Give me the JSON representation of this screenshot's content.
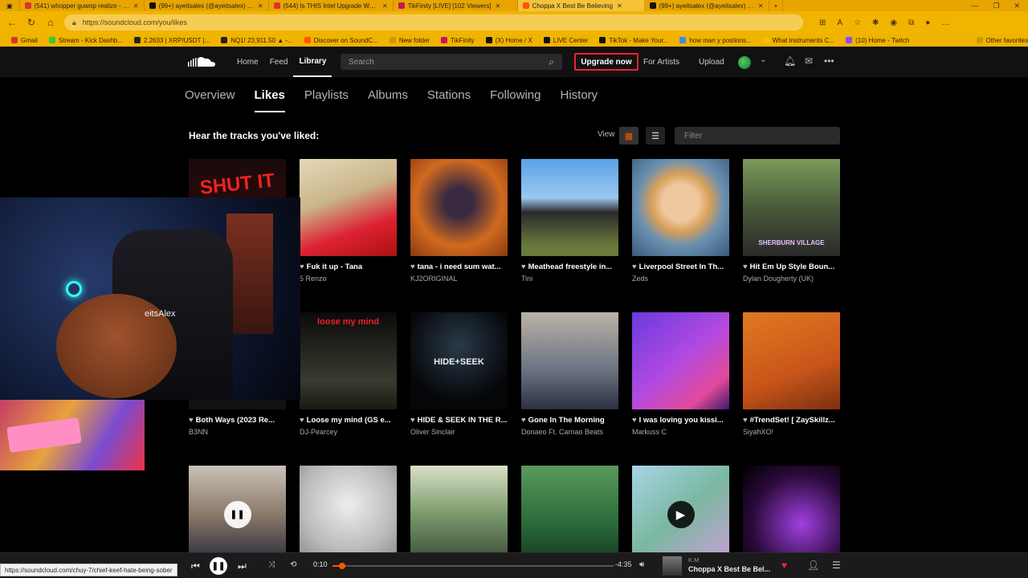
{
  "browser": {
    "tabs": [
      {
        "label": "(541) whopper guwop realize - Yo",
        "color": "#d33"
      },
      {
        "label": "(99+) ayeitsalex (@ayeitsalex) | Ti",
        "color": "#111"
      },
      {
        "label": "(544) Is THIS Intel Upgrade Worth",
        "color": "#d33"
      },
      {
        "label": "TikFinity [LIVE] [102 Viewers]",
        "color": "#c2185b"
      },
      {
        "label": "Choppa X Best Be Believing",
        "color": "#f50"
      },
      {
        "label": "(99+) ayeitsalex (@ayeitsalex) | Ti",
        "color": "#111"
      }
    ],
    "url": "https://soundcloud.com/you/likes",
    "bookmarks": [
      {
        "label": "Gmail",
        "color": "#d33"
      },
      {
        "label": "Stream - Kick Dashb...",
        "color": "#3c3"
      },
      {
        "label": "2.2633 | XRP/USDT |...",
        "color": "#222"
      },
      {
        "label": "NQ1! 23,911.50 ▲ -...",
        "color": "#222"
      },
      {
        "label": "Discover on SoundC...",
        "color": "#f50"
      },
      {
        "label": "New folder",
        "color": "#c90"
      },
      {
        "label": "TikFinity",
        "color": "#c2185b"
      },
      {
        "label": "(X) Home / X",
        "color": "#111"
      },
      {
        "label": "LIVE Center",
        "color": "#111"
      },
      {
        "label": "TikTok - Make Your...",
        "color": "#111"
      },
      {
        "label": "how man y postions...",
        "color": "#4285f4"
      },
      {
        "label": "What Instruments C...",
        "color": "#fbbc04"
      },
      {
        "label": "(10) Home - Twitch",
        "color": "#9146ff"
      },
      {
        "label": "Other favorites",
        "color": "#c90"
      }
    ]
  },
  "header": {
    "nav": [
      "Home",
      "Feed",
      "Library"
    ],
    "active_nav": "Library",
    "search_placeholder": "Search",
    "upgrade": "Upgrade now",
    "for_artists": "For Artists",
    "upload": "Upload"
  },
  "subtabs": [
    "Overview",
    "Likes",
    "Playlists",
    "Albums",
    "Stations",
    "Following",
    "History"
  ],
  "active_subtab": "Likes",
  "section_title": "Hear the tracks you've liked:",
  "view_label": "View",
  "filter_placeholder": "Filter",
  "tracks": [
    {
      "title": "",
      "artist": "",
      "art": "shut it",
      "art_text": "SHUT IT"
    },
    {
      "title": "Fuk it up - Tana",
      "artist": "5 Renzo",
      "art": "photo1"
    },
    {
      "title": "tana - i need sum wat...",
      "artist": "KJ2ORIGINAL",
      "art": "photo2"
    },
    {
      "title": "Meathead freestyle in...",
      "artist": "Tini",
      "art": "photo3"
    },
    {
      "title": "Liverpool Street In Th...",
      "artist": "Zeds",
      "art": "photo4"
    },
    {
      "title": "Hit Em Up Style Boun...",
      "artist": "Dylan Dougherty (UK)",
      "art": "photo5",
      "art_text": "SHERBURN VILLAGE"
    },
    {
      "title": "Both Ways (2023 Re...",
      "artist": "B3NN",
      "art": "photo6"
    },
    {
      "title": "Loose my mind (GS e...",
      "artist": "DJ-Pearcey",
      "art": "photo7",
      "art_text": "loose my mind"
    },
    {
      "title": "HIDE & SEEK IN THE R...",
      "artist": "Oliver Sinclair",
      "art": "photo8",
      "art_text": "HIDE+SEEK"
    },
    {
      "title": "Gone In The Morning",
      "artist": "Donaeo Ft. Carnao Beats",
      "art": "photo9"
    },
    {
      "title": "I was loving you kissi...",
      "artist": "Markuss C",
      "art": "photo10"
    },
    {
      "title": "#TrendSet! [ ZaySkillz...",
      "artist": "SiyahXO!",
      "art": "photo11"
    },
    {
      "title": "",
      "artist": "",
      "art": "photo12"
    },
    {
      "title": "",
      "artist": "",
      "art": "photo13"
    },
    {
      "title": "",
      "artist": "",
      "art": "photo14"
    },
    {
      "title": "",
      "artist": "",
      "art": "photo15"
    },
    {
      "title": "",
      "artist": "",
      "art": "photo16"
    },
    {
      "title": "",
      "artist": "",
      "art": "photo17"
    }
  ],
  "webcam": {
    "name_text": "eitsAlex"
  },
  "player": {
    "elapsed": "0:10",
    "remaining": "-4:35",
    "progress": 0.035,
    "artist": "K.M",
    "title": "Choppa X Best Be Bel...",
    "status_url": "https://soundcloud.com/chuy-7/chief-keef-hate-being-sober"
  },
  "colors": {
    "accent": "#ff5500",
    "chrome": "#f1b400",
    "upgrade_border": "#ee2233"
  }
}
